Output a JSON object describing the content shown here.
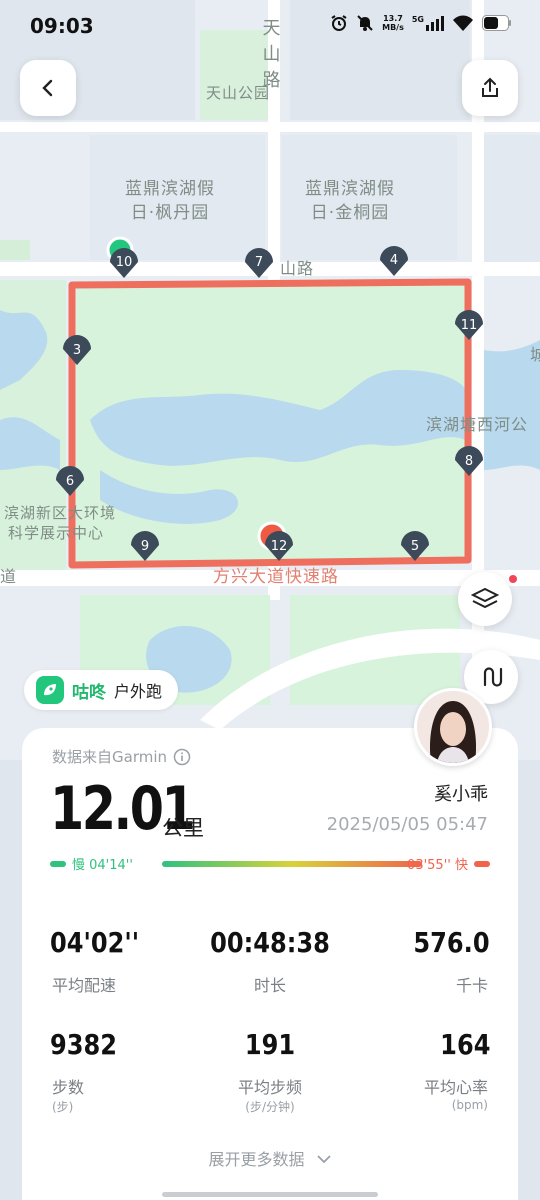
{
  "status": {
    "time": "09:03",
    "net_speed": "13.7",
    "net_unit": "MB/s",
    "net_type": "5G"
  },
  "map": {
    "labels": {
      "road_tianshan": "天山路",
      "park_tianshan": "天山公园",
      "estate_1a": "蓝鼎滨湖假",
      "estate_1b": "日·枫丹园",
      "estate_2a": "蓝鼎滨湖假",
      "estate_2b": "日·金桐园",
      "road_shan": "山路",
      "river": "滨湖塘西河公",
      "center_a": "滨湖新区大环境",
      "center_b": "科学展示中心",
      "expressway": "方兴大道快速路",
      "edge_left": "道",
      "edge_right": "城"
    },
    "markers": [
      "10",
      "7",
      "4",
      "3",
      "11",
      "8",
      "6",
      "9",
      "12",
      "5"
    ],
    "route_color": "#ef6f5e"
  },
  "app": {
    "name": "咕咚",
    "activity": "户外跑"
  },
  "summary": {
    "source": "数据来自Garmin",
    "distance": "12.01",
    "distance_unit": "公里",
    "user": "奚小乖",
    "datetime": "2025/05/05 05:47",
    "pace_slow": "慢 04'14''",
    "pace_fast": "03'55'' 快"
  },
  "stats": [
    {
      "value": "04'02''",
      "label": "平均配速"
    },
    {
      "value": "00:48:38",
      "label": "时长"
    },
    {
      "value": "576.0",
      "label": "千卡"
    },
    {
      "value": "9382",
      "label": "步数",
      "sub": "(步)"
    },
    {
      "value": "191",
      "label": "平均步频",
      "sub": "(步/分钟)"
    },
    {
      "value": "164",
      "label": "平均心率",
      "sub": "(bpm)"
    }
  ],
  "more_label": "展开更多数据",
  "colors": {
    "accent_green": "#22c77d",
    "route_red": "#ef6f5e"
  }
}
